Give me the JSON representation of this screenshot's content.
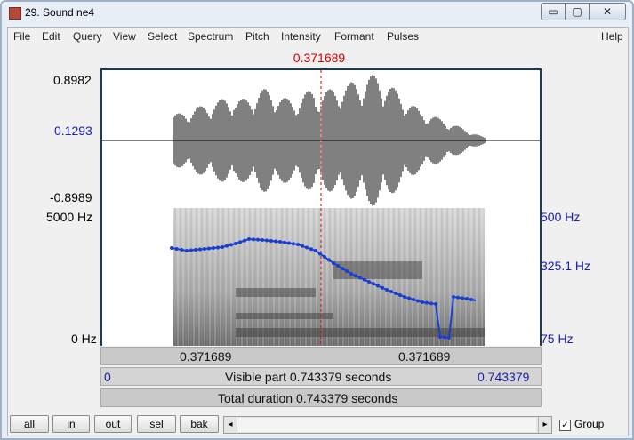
{
  "window": {
    "title": "29. Sound ne4",
    "minimize_glyph": "▭",
    "maximize_glyph": "▢",
    "close_glyph": "✕"
  },
  "menu": {
    "items": [
      "File",
      "Edit",
      "Query",
      "View",
      "Select",
      "Spectrum",
      "Pitch",
      "Intensity",
      "Formant",
      "Pulses"
    ],
    "help": "Help"
  },
  "cursor": {
    "time_label": "0.371689",
    "color": "#d40000"
  },
  "waveform": {
    "max_label": "0.8982",
    "mid_label": "0.1293",
    "min_label": "-0.8989"
  },
  "spectrogram": {
    "top_freq": "5000 Hz",
    "bottom_freq": "0 Hz",
    "pitch_top": "500 Hz",
    "pitch_mid": "325.1 Hz",
    "pitch_bottom": "75 Hz",
    "pitch_color": "#1a3fd0"
  },
  "time_bar": {
    "left": "0.371689",
    "right": "0.371689"
  },
  "visible_bar": {
    "start": "0",
    "text": "Visible part 0.743379 seconds",
    "end": "0.743379"
  },
  "total_bar": {
    "text": "Total duration 0.743379 seconds"
  },
  "buttons": {
    "all": "all",
    "in": "in",
    "out": "out",
    "sel": "sel",
    "bak": "bak"
  },
  "scrollbar": {
    "left_arrow": "◂",
    "right_arrow": "▸"
  },
  "group": {
    "checked": true,
    "label": "Group",
    "check_glyph": "✓"
  }
}
